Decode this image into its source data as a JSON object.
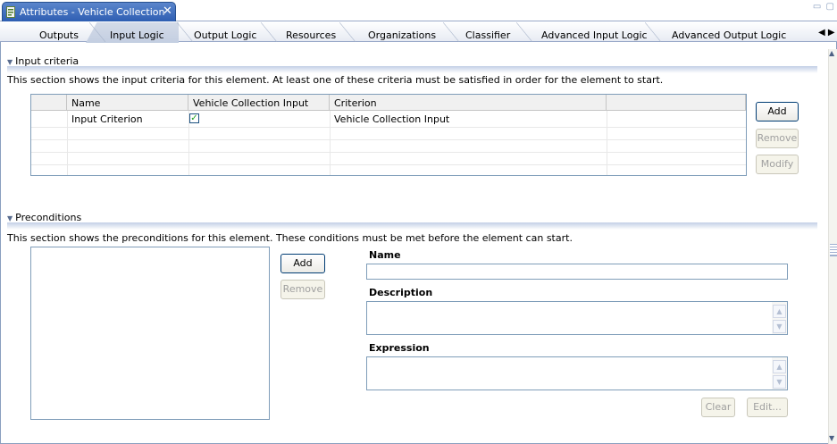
{
  "window": {
    "tab_title": "Attributes - Vehicle Collection",
    "close_glyph": "✕",
    "icon": "attributes-editor-icon",
    "controls": "▭ ▢"
  },
  "page_tabs": [
    {
      "label": "Outputs",
      "active": false
    },
    {
      "label": "Input Logic",
      "active": true
    },
    {
      "label": "Output Logic",
      "active": false
    },
    {
      "label": "Resources",
      "active": false
    },
    {
      "label": "Organizations",
      "active": false
    },
    {
      "label": "Classifier",
      "active": false
    },
    {
      "label": "Advanced Input Logic",
      "active": false
    },
    {
      "label": "Advanced Output Logic",
      "active": false
    }
  ],
  "tabs_scroll_glyph": "◀ ▶",
  "input_criteria": {
    "title": "Input criteria",
    "description": "This section shows the input criteria for this element. At least one of these criteria must be satisfied in order for the element to start.",
    "columns": [
      "",
      "Name",
      "Vehicle Collection Input",
      "Criterion",
      ""
    ],
    "rows": [
      {
        "name": "Input Criterion",
        "vehicle_collection_input": true,
        "criterion": "Vehicle Collection Input"
      }
    ],
    "buttons": {
      "add": "Add",
      "remove": "Remove",
      "modify": "Modify"
    }
  },
  "preconditions": {
    "title": "Preconditions",
    "description": "This section shows the preconditions for this element. These conditions must be met before the element can start.",
    "buttons": {
      "add": "Add",
      "remove": "Remove",
      "clear": "Clear",
      "edit": "Edit..."
    },
    "fields": {
      "name_label": "Name",
      "name_value": "",
      "description_label": "Description",
      "description_value": "",
      "expression_label": "Expression",
      "expression_value": ""
    }
  },
  "glyphs": {
    "twistie": "▼",
    "check": "✓",
    "up": "▲",
    "down": "▼"
  },
  "colors": {
    "tab_active": "#2e5eb2",
    "header_accent": "#c3cfe6",
    "border": "#7f9db9"
  }
}
